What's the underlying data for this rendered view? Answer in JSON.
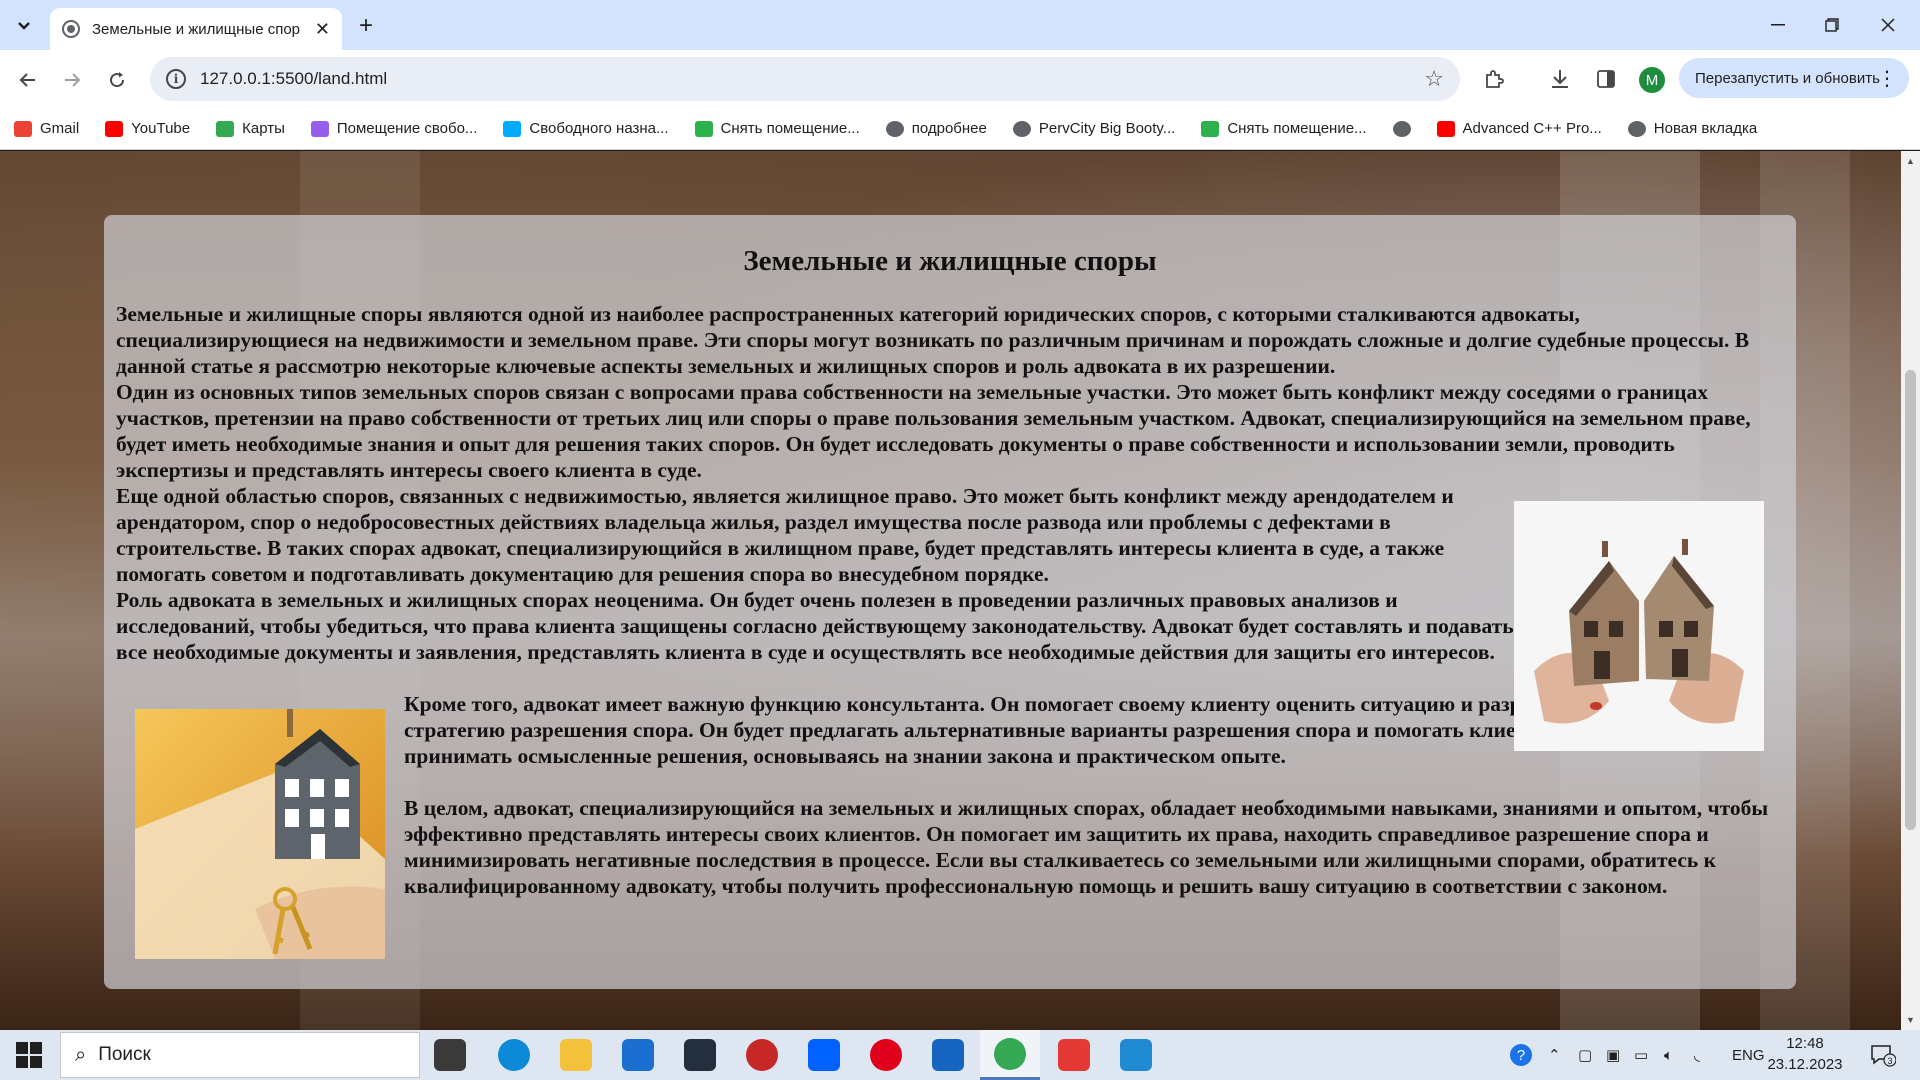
{
  "browser": {
    "tab_title": "Земельные и жилищные спор",
    "new_tab_symbol": "+",
    "url": "127.0.0.1:5500/land.html",
    "update_button_label": "Перезапустить и обновить",
    "profile_initial": "M"
  },
  "bookmarks": [
    {
      "label": "Gmail",
      "icon": "gmail-icon",
      "color": "#ea4335"
    },
    {
      "label": "YouTube",
      "icon": "youtube-icon",
      "color": "#ff0000"
    },
    {
      "label": "Карты",
      "icon": "maps-icon",
      "color": "#34a853"
    },
    {
      "label": "Помещение свобо...",
      "icon": "avito-icon",
      "color": "#965eeb"
    },
    {
      "label": "Свободного назна...",
      "icon": "avito-icon",
      "color": "#00aaff"
    },
    {
      "label": "Снять помещение...",
      "icon": "cian-icon",
      "color": "#2bb24c"
    },
    {
      "label": "подробнее",
      "icon": "globe-icon",
      "color": "#5f6368"
    },
    {
      "label": "PervCity Big Booty...",
      "icon": "globe-icon",
      "color": "#5f6368"
    },
    {
      "label": "Снять помещение...",
      "icon": "cian-icon",
      "color": "#2bb24c"
    },
    {
      "label": "",
      "icon": "globe-icon",
      "color": "#5f6368"
    },
    {
      "label": "Advanced C++ Pro...",
      "icon": "youtube-icon",
      "color": "#ff0000"
    },
    {
      "label": "Новая вкладка",
      "icon": "globe-icon",
      "color": "#5f6368"
    }
  ],
  "article": {
    "title": "Земельные и жилищные споры",
    "p1": "Земельные и жилищные споры являются одной из наиболее распространенных категорий юридических споров, с которыми сталкиваются адвокаты, специализирующиеся на недвижимости и земельном праве. Эти споры могут возникать по различным причинам и порождать сложные и долгие судебные процессы. В данной статье я рассмотрю некоторые ключевые аспекты земельных и жилищных споров и роль адвоката в их разрешении.",
    "p2": "Один из основных типов земельных споров связан с вопросами права собственности на земельные участки. Это может быть конфликт между соседями о границах участков, претензии на право собственности от третьих лиц или споры о праве пользования земельным участком. Адвокат, специализирующийся на земельном праве, будет иметь необходимые знания и опыт для решения таких споров. Он будет исследовать документы о праве собственности и использовании земли, проводить экспертизы и представлять интересы своего клиента в суде.",
    "p3": "Еще одной областью споров, связанных с недвижимостью, является жилищное право. Это может быть конфликт между арендодателем и арендатором, спор о недобросовестных действиях владельца жилья, раздел имущества после развода или проблемы с дефектами в строительстве. В таких спорах адвокат, специализирующийся в жилищном праве, будет представлять интересы клиента в суде, а также помогать советом и подготавливать документацию для решения спора во внесудебном порядке.",
    "p4": "Роль адвоката в земельных и жилищных спорах неоценима. Он будет очень полезен в проведении различных правовых анализов и исследований, чтобы убедиться, что права клиента защищены согласно действующему законодательству. Адвокат будет составлять и подавать все необходимые документы и заявления, представлять клиента в суде и осуществлять все необходимые действия для защиты его интересов.",
    "p5": "Кроме того, адвокат имеет важную функцию консультанта. Он помогает своему клиенту оценить ситуацию и разработать стратегию разрешения спора. Он будет предлагать альтернативные варианты разрешения спора и помогать клиенту принимать осмысленные решения, основываясь на знании закона и практическом опыте.",
    "p6": "В целом, адвокат, специализирующийся на земельных и жилищных спорах, обладает необходимыми навыками, знаниями и опытом, чтобы эффективно представлять интересы своих клиентов. Он помогает им защитить их права, находить справедливое разрешение спора и минимизировать негативные последствия в процессе. Если вы сталкиваетесь со земельными или жилищными спорами, обратитесь к квалифицированному адвокату, чтобы получить профессиональную помощь и решить вашу ситуацию в соответствии с законом."
  },
  "taskbar": {
    "search_placeholder": "Поиск",
    "apps": [
      {
        "name": "task-view",
        "color": "#3a3a3a"
      },
      {
        "name": "edge",
        "color": "#0c8ad8"
      },
      {
        "name": "file-explorer",
        "color": "#f3c13a"
      },
      {
        "name": "mail",
        "color": "#1a6fd1"
      },
      {
        "name": "amazon",
        "color": "#232f3e"
      },
      {
        "name": "security-app",
        "color": "#c62828"
      },
      {
        "name": "dropbox",
        "color": "#0061fe"
      },
      {
        "name": "opera",
        "color": "#e0001b"
      },
      {
        "name": "shield-app",
        "color": "#1565c0"
      },
      {
        "name": "chrome",
        "color": "#34a853"
      },
      {
        "name": "pdf-app",
        "color": "#e53935"
      },
      {
        "name": "vscode",
        "color": "#1f8ad2"
      }
    ],
    "language": "ENG",
    "time": "12:48",
    "date": "23.12.2023",
    "notifications_count": "3"
  }
}
